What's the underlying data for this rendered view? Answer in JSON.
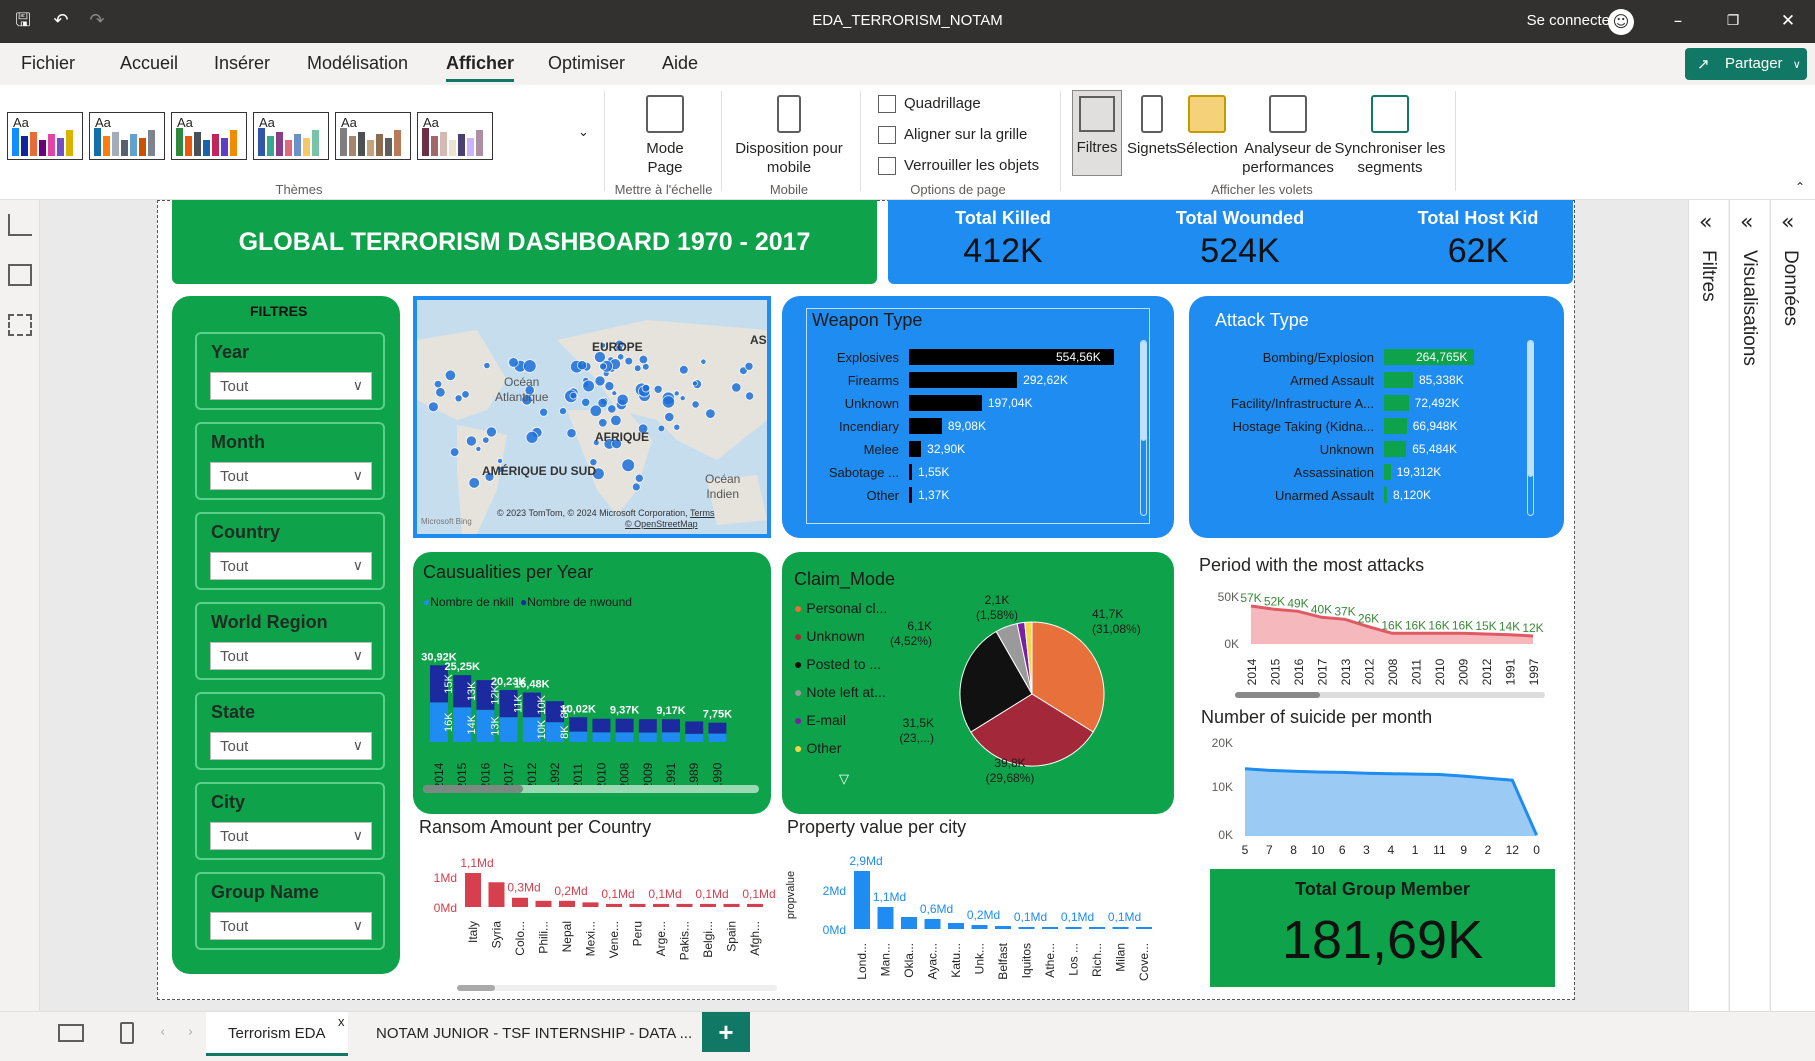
{
  "window": {
    "title": "EDA_TERRORISM_NOTAM",
    "signin": "Se connecter"
  },
  "menu": {
    "items": [
      "Fichier",
      "Accueil",
      "Insérer",
      "Modélisation",
      "Afficher",
      "Optimiser",
      "Aide"
    ],
    "active": "Afficher",
    "share": "Partager"
  },
  "ribbon": {
    "themes_label": "Thèmes",
    "themes": [
      {
        "label": "Aa",
        "colors": [
          "#118dff",
          "#12239e",
          "#e66c37",
          "#6b007b",
          "#e044a7",
          "#744ec2",
          "#d9b300"
        ]
      },
      {
        "label": "Aa",
        "colors": [
          "#1170aa",
          "#fc7d0b",
          "#a3acb9",
          "#57606c",
          "#5fa2ce",
          "#c85200",
          "#7b848f"
        ]
      },
      {
        "label": "Aa",
        "colors": [
          "#2b8a3e",
          "#e8590c",
          "#495057",
          "#1864ab",
          "#c2255c",
          "#5f3dc4",
          "#f08c00"
        ]
      },
      {
        "label": "Aa",
        "colors": [
          "#3257a8",
          "#37a794",
          "#8b3d88",
          "#dd6b7f",
          "#6b91c9",
          "#f5c869",
          "#77c4a8"
        ]
      },
      {
        "label": "Aa",
        "colors": [
          "#7f7f7f",
          "#a5866d",
          "#4e4f4f",
          "#c4a27d",
          "#8f6c4d",
          "#5e5e5e",
          "#b97a57"
        ]
      },
      {
        "label": "Aa",
        "colors": [
          "#6d2e46",
          "#a26769",
          "#d5b9b2",
          "#ece2d0",
          "#4b3f72",
          "#cbb2fe",
          "#b08ea2"
        ]
      }
    ],
    "scale": {
      "label": "Mode\nPage",
      "group": "Mettre à l'échelle"
    },
    "mobile": {
      "label": "Disposition pour\nmobile",
      "group": "Mobile"
    },
    "options": {
      "group": "Options de page",
      "gridlines": "Quadrillage",
      "snap": "Aligner sur la grille",
      "lock": "Verrouiller les objets"
    },
    "panes": {
      "group": "Afficher les volets",
      "filters": "Filtres",
      "bookmarks": "Signets",
      "selection": "Sélection",
      "performance": "Analyseur de\nperformances",
      "sync": "Synchroniser les\nsegments"
    }
  },
  "right_panes": {
    "filters": "Filtres",
    "visualizations": "Visualisations",
    "data": "Données"
  },
  "pages": {
    "active": "Terrorism EDA",
    "other": "NOTAM JUNIOR - TSF INTERNSHIP - DATA ..."
  },
  "dashboard": {
    "title": "GLOBAL TERRORISM DASHBOARD 1970 - 2017",
    "kpis": [
      {
        "label": "Total Killed",
        "value": "412K"
      },
      {
        "label": "Total Wounded",
        "value": "524K"
      },
      {
        "label": "Total Host Kid",
        "value": "62K"
      }
    ],
    "filters_title": "FILTRES",
    "slicers": [
      {
        "label": "Year",
        "value": "Tout"
      },
      {
        "label": "Month",
        "value": "Tout"
      },
      {
        "label": "Country",
        "value": "Tout"
      },
      {
        "label": "World Region",
        "value": "Tout"
      },
      {
        "label": "State",
        "value": "Tout"
      },
      {
        "label": "City",
        "value": "Tout"
      },
      {
        "label": "Group Name",
        "value": "Tout"
      }
    ],
    "map": {
      "labels": {
        "europe": "EUROPE",
        "asia": "AS",
        "atlantic": "Océan\nAtlantique",
        "africa": "AFRIQUE",
        "south_america": "AMÉRIQUE DU SUD",
        "indian": "Océan\nIndien"
      },
      "attribution": "© 2023 TomTom, © 2024 Microsoft Corporation,",
      "terms": "Terms",
      "osm": "© OpenStreetMap",
      "bing": "Microsoft Bing"
    },
    "weapon": {
      "title": "Weapon Type",
      "rows": [
        {
          "cat": "Explosives",
          "value": 554.56,
          "label": "554,56K"
        },
        {
          "cat": "Firearms",
          "value": 292.62,
          "label": "292,62K"
        },
        {
          "cat": "Unknown",
          "value": 197.04,
          "label": "197,04K"
        },
        {
          "cat": "Incendiary",
          "value": 89.08,
          "label": "89,08K"
        },
        {
          "cat": "Melee",
          "value": 32.9,
          "label": "32,90K"
        },
        {
          "cat": "Sabotage ...",
          "value": 1.55,
          "label": "1,55K"
        },
        {
          "cat": "Other",
          "value": 1.37,
          "label": "1,37K"
        }
      ]
    },
    "attack": {
      "title": "Attack Type",
      "rows": [
        {
          "cat": "Bombing/Explosion",
          "value": 264.765,
          "label": "264,765K"
        },
        {
          "cat": "Armed Assault",
          "value": 85.338,
          "label": "85,338K"
        },
        {
          "cat": "Facility/Infrastructure A...",
          "value": 72.492,
          "label": "72,492K"
        },
        {
          "cat": "Hostage Taking (Kidna...",
          "value": 66.948,
          "label": "66,948K"
        },
        {
          "cat": "Unknown",
          "value": 65.484,
          "label": "65,484K"
        },
        {
          "cat": "Assassination",
          "value": 19.312,
          "label": "19,312K"
        },
        {
          "cat": "Unarmed Assault",
          "value": 8.12,
          "label": "8,120K"
        }
      ]
    },
    "claim": {
      "title": "Claim_Mode",
      "legend": [
        {
          "name": "Personal cl...",
          "color": "#e8703a"
        },
        {
          "name": "Unknown",
          "color": "#a3293a"
        },
        {
          "name": "Posted to ...",
          "color": "#111111"
        },
        {
          "name": "Note left at...",
          "color": "#9a9a9a"
        },
        {
          "name": "E-mail",
          "color": "#7a1fa2"
        },
        {
          "name": "Other",
          "color": "#f0d84a"
        }
      ]
    },
    "period": {
      "title": "Period with the most attacks"
    },
    "suicide": {
      "title": "Number of suicide per month"
    },
    "casualties": {
      "title": "Causualities per Year",
      "legend": [
        {
          "name": "Nombre de nkill",
          "color": "#1e8cf0"
        },
        {
          "name": "Nombre de nwound",
          "color": "#1b2a9e"
        }
      ]
    },
    "ransom": {
      "title": "Ransom Amount per Country"
    },
    "property": {
      "title": "Property value per city"
    },
    "group_member": {
      "label": "Total Group Member",
      "value": "181,69K"
    }
  },
  "chart_data": [
    {
      "type": "bar",
      "title": "Weapon Type",
      "categories": [
        "Explosives",
        "Firearms",
        "Unknown",
        "Incendiary",
        "Melee",
        "Sabotage ...",
        "Other"
      ],
      "values": [
        554.56,
        292.62,
        197.04,
        89.08,
        32.9,
        1.55,
        1.37
      ],
      "data_labels": [
        "554,56K",
        "292,62K",
        "197,04K",
        "89,08K",
        "32,90K",
        "1,55K",
        "1,37K"
      ],
      "orientation": "horizontal",
      "color": "#000000"
    },
    {
      "type": "bar",
      "title": "Attack Type",
      "categories": [
        "Bombing/Explosion",
        "Armed Assault",
        "Facility/Infrastructure A...",
        "Hostage Taking (Kidna...",
        "Unknown",
        "Assassination",
        "Unarmed Assault"
      ],
      "values": [
        264.765,
        85.338,
        72.492,
        66.948,
        65.484,
        19.312,
        8.12
      ],
      "data_labels": [
        "264,765K",
        "85,338K",
        "72,492K",
        "66,948K",
        "65,484K",
        "19,312K",
        "8,120K"
      ],
      "orientation": "horizontal",
      "color": "#0ea24a"
    },
    {
      "type": "bar",
      "title": "Causualities per Year",
      "stacked": true,
      "categories": [
        "2014",
        "2015",
        "2016",
        "2017",
        "2012",
        "1992",
        "2011",
        "2010",
        "2008",
        "2009",
        "1991",
        "1989",
        "1990"
      ],
      "series": [
        {
          "name": "Nombre de nkill",
          "values": [
            16,
            14,
            13,
            10,
            10,
            8,
            4.2,
            3.9,
            3.9,
            3.8,
            3.9,
            3.3,
            3.4
          ],
          "labels": [
            "16K",
            "14K",
            "13K",
            "",
            "10K",
            "8K",
            "",
            "",
            "",
            "",
            "",
            "",
            ""
          ]
        },
        {
          "name": "Nombre de nwound",
          "values": [
            15,
            13,
            12,
            11,
            10,
            8.5,
            5.8,
            5.5,
            5.5,
            5.4,
            5.3,
            5.0,
            4.4
          ],
          "labels": [
            "15K",
            "13K",
            "12K",
            "11K",
            "10K",
            "8K",
            "",
            "",
            "",
            "",
            "",
            "",
            ""
          ]
        }
      ],
      "totals_labels": [
        "30,92K",
        "25,25K",
        "",
        "20,23K",
        "16,48K",
        "",
        "10,02K",
        "",
        "9,37K",
        "",
        "9,17K",
        "",
        "7,75K"
      ]
    },
    {
      "type": "pie",
      "title": "Claim_Mode",
      "categories": [
        "Personal cl...",
        "Unknown",
        "Posted to ...",
        "Note left at...",
        "E-mail",
        "Other"
      ],
      "values": [
        41.7,
        39.8,
        31.5,
        6.1,
        2.1,
        2.0
      ],
      "labels": [
        "41,7K\n(31,08%)",
        "39,8K\n(29,68%)",
        "31,5K\n(23,...)",
        "6,1K\n(4,52%)",
        "2,1K\n(1,58%)",
        ""
      ],
      "colors": [
        "#e8703a",
        "#a3293a",
        "#111111",
        "#9a9a9a",
        "#7a1fa2",
        "#f0d84a"
      ]
    },
    {
      "type": "area",
      "title": "Period with the most attacks",
      "categories": [
        "2014",
        "2015",
        "2016",
        "2017",
        "2013",
        "2012",
        "2008",
        "2011",
        "2010",
        "2009",
        "2012",
        "1991",
        "1997"
      ],
      "values": [
        57,
        52,
        49,
        40,
        37,
        26,
        16,
        16,
        16,
        16,
        15,
        14,
        12
      ],
      "data_labels": [
        "57K",
        "52K",
        "49K",
        "40K",
        "37K",
        "26K",
        "16K",
        "16K",
        "16K",
        "16K",
        "15K",
        "14K",
        "12K"
      ],
      "y_ticks": [
        "50K",
        "0K"
      ],
      "ylim": [
        0,
        60
      ],
      "color": "#e05a64"
    },
    {
      "type": "area",
      "title": "Number of suicide per month",
      "categories": [
        "5",
        "7",
        "8",
        "10",
        "6",
        "3",
        "4",
        "1",
        "11",
        "9",
        "2",
        "12",
        "0"
      ],
      "values": [
        16.4,
        16.0,
        15.8,
        15.6,
        15.5,
        15.3,
        15.2,
        15.1,
        15.0,
        14.6,
        14.1,
        13.6,
        0.2
      ],
      "y_ticks": [
        "20K",
        "10K",
        "0K"
      ],
      "ylim": [
        0,
        20
      ],
      "color": "#1e8cf0"
    },
    {
      "type": "bar",
      "title": "Ransom Amount per Country",
      "categories": [
        "Italy",
        "Syria",
        "Colo...",
        "Phili...",
        "Nepal",
        "Mexi...",
        "Vene...",
        "Peru",
        "Arge...",
        "Pakis...",
        "Belgi...",
        "Spain",
        "Afgh..."
      ],
      "values": [
        1.1,
        0.8,
        0.3,
        0.2,
        0.2,
        0.15,
        0.1,
        0.1,
        0.1,
        0.1,
        0.1,
        0.1,
        0.1
      ],
      "data_labels": [
        "1,1Md",
        "",
        "0,3Md",
        "",
        "0,2Md",
        "",
        "0,1Md",
        "",
        "0,1Md",
        "",
        "0,1Md",
        "",
        "0,1Md"
      ],
      "y_ticks": [
        "1Md",
        "0Md"
      ],
      "color": "#d6404e"
    },
    {
      "type": "bar",
      "title": "Property value per city",
      "ylabel": "propvalue",
      "categories": [
        "Lond...",
        "Man...",
        "Okla...",
        "Ayac...",
        "Katu...",
        "Unk...",
        "Belfast",
        "Iquitos",
        "Athe...",
        "Los ...",
        "Rich...",
        "Milan",
        "Cove..."
      ],
      "values": [
        2.9,
        1.1,
        0.6,
        0.5,
        0.3,
        0.2,
        0.15,
        0.1,
        0.1,
        0.1,
        0.1,
        0.1,
        0.1
      ],
      "data_labels": [
        "2,9Md",
        "1,1Md",
        "",
        "0,6Md",
        "",
        "0,2Md",
        "",
        "0,1Md",
        "",
        "0,1Md",
        "",
        "0,1Md",
        ""
      ],
      "y_ticks": [
        "2Md",
        "0Md"
      ],
      "color": "#1e8cf0"
    }
  ]
}
